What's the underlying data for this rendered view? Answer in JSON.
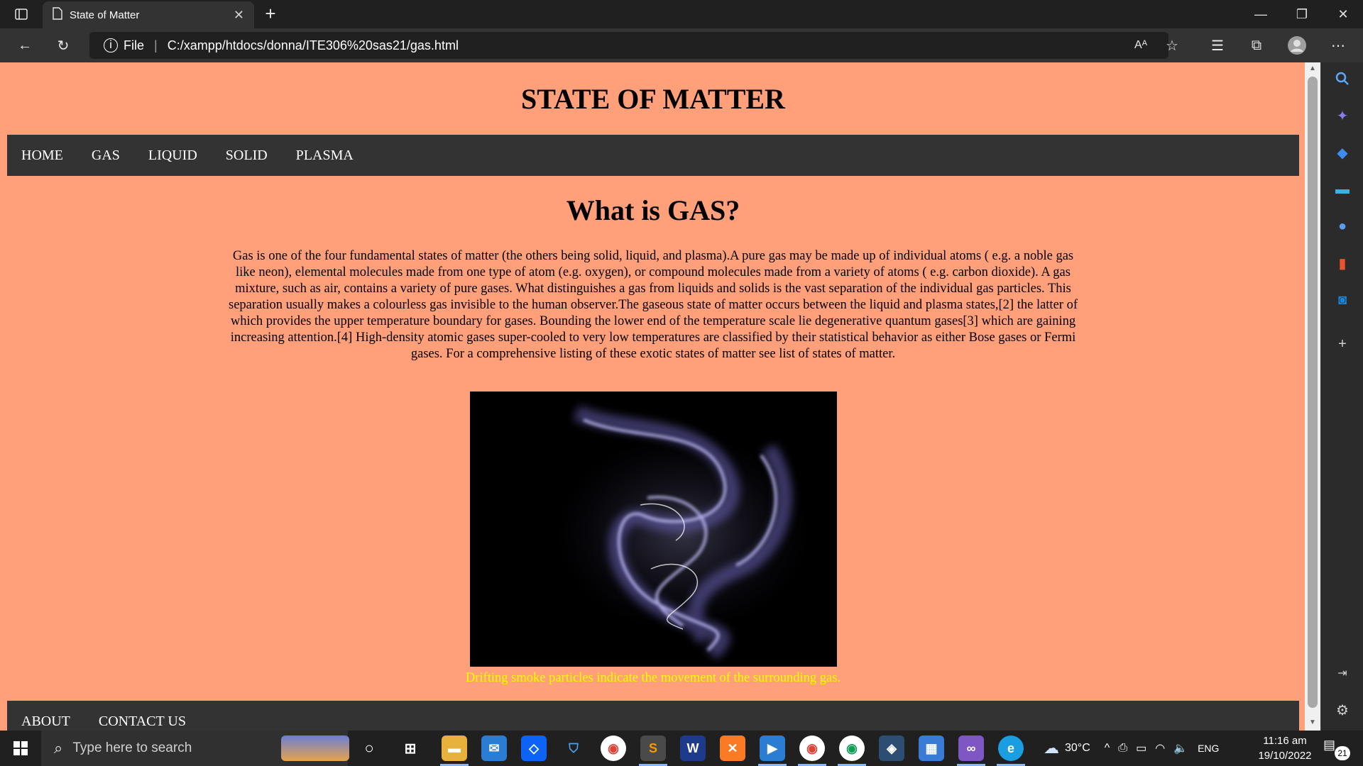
{
  "browser": {
    "tab_title": "State of Matter",
    "address_label": "File",
    "url": "C:/xampp/htdocs/donna/ITE306%20sas21/gas.html"
  },
  "page": {
    "site_title": "STATE OF MATTER",
    "nav": [
      "HOME",
      "GAS",
      "LIQUID",
      "SOLID",
      "PLASMA"
    ],
    "heading": "What is GAS?",
    "intro": "Gas is one of the four fundamental states of matter (the others being solid, liquid, and plasma).A pure gas may be made up of individual atoms ( e.g. a noble gas like neon), elemental molecules made from one type of atom (e.g. oxygen), or compound molecules made from a variety of atoms ( e.g. carbon dioxide). A gas mixture, such as air, contains a variety of pure gases. What distinguishes a gas from liquids and solids is the vast separation of the individual gas particles. This separation usually makes a colourless gas invisible to the human observer.The gaseous state of matter occurs between the liquid and plasma states,[2] the latter of which provides the upper temperature boundary for gases. Bounding the lower end of the temperature scale lie degenerative quantum gases[3] which are gaining increasing attention.[4] High-density atomic gases super-cooled to very low temperatures are classified by their statistical behavior as either Bose gases or Fermi gases. For a comprehensive listing of these exotic states of matter see list of states of matter.",
    "caption": "Drifting smoke particles indicate the movement of the surrounding gas.",
    "footer_nav": [
      "ABOUT",
      "CONTACT US"
    ],
    "colors": {
      "page_bg": "#ffa07a",
      "nav_bg": "#333333",
      "caption": "#ffff00"
    }
  },
  "taskbar": {
    "search_placeholder": "Type here to search",
    "weather": "30°C",
    "language": "ENG",
    "time": "11:16 am",
    "date": "19/10/2022",
    "notification_count": "21"
  }
}
